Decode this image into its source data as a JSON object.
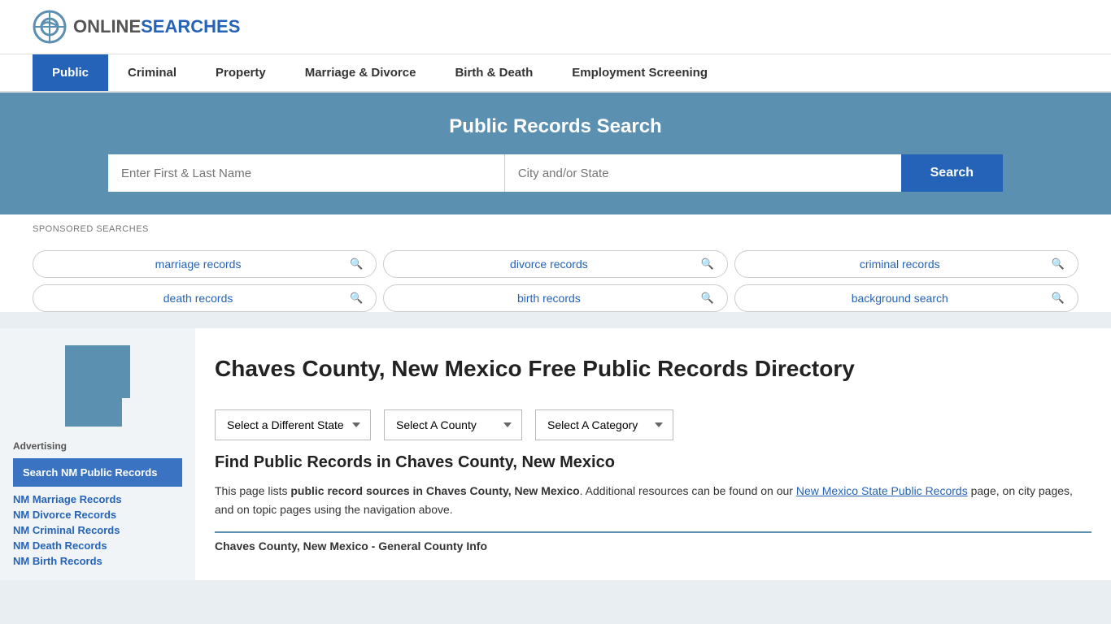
{
  "site": {
    "logo_online": "ONLINE",
    "logo_searches": "SEARCHES"
  },
  "nav": {
    "items": [
      {
        "label": "Public",
        "active": true
      },
      {
        "label": "Criminal",
        "active": false
      },
      {
        "label": "Property",
        "active": false
      },
      {
        "label": "Marriage & Divorce",
        "active": false
      },
      {
        "label": "Birth & Death",
        "active": false
      },
      {
        "label": "Employment Screening",
        "active": false
      }
    ]
  },
  "hero": {
    "title": "Public Records Search",
    "name_placeholder": "Enter First & Last Name",
    "location_placeholder": "City and/or State",
    "search_label": "Search"
  },
  "sponsored": {
    "label": "SPONSORED SEARCHES",
    "tags": [
      {
        "text": "marriage records"
      },
      {
        "text": "divorce records"
      },
      {
        "text": "criminal records"
      },
      {
        "text": "death records"
      },
      {
        "text": "birth records"
      },
      {
        "text": "background search"
      }
    ]
  },
  "page": {
    "title": "Chaves County, New Mexico Free Public Records Directory"
  },
  "dropdowns": {
    "state_label": "Select a Different State",
    "county_label": "Select A County",
    "category_label": "Select A Category"
  },
  "content": {
    "find_title": "Find Public Records in Chaves County, New Mexico",
    "find_desc_part1": "This page lists ",
    "find_desc_bold": "public record sources in Chaves County, New Mexico",
    "find_desc_part2": ". Additional resources can be found on our ",
    "find_link_text": "New Mexico State Public Records",
    "find_desc_part3": " page, on city pages, and on topic pages using the navigation above."
  },
  "sidebar": {
    "ad_label": "Advertising",
    "ad_block_text": "Search NM Public Records",
    "links": [
      {
        "text": "NM Marriage Records"
      },
      {
        "text": "NM Divorce Records"
      },
      {
        "text": "NM Criminal Records"
      },
      {
        "text": "NM Death Records"
      },
      {
        "text": "NM Birth Records"
      }
    ]
  },
  "county_info": {
    "label": "Chaves County, New Mexico - General County Info"
  }
}
